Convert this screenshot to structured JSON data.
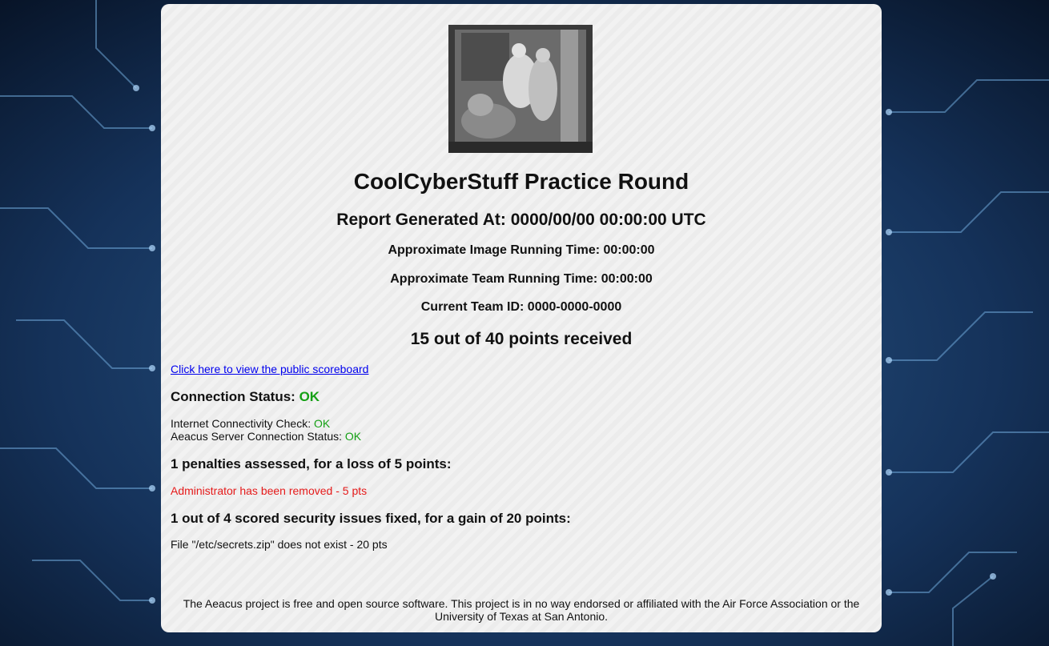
{
  "report": {
    "title": "CoolCyberStuff Practice Round",
    "generated": "Report Generated At: 0000/00/00 00:00:00 UTC",
    "image_time": "Approximate Image Running Time: 00:00:00",
    "team_time": "Approximate Team Running Time: 00:00:00",
    "team_id": "Current Team ID: 0000-0000-0000",
    "points": "15 out of 40 points received",
    "scoreboard_link": "Click here to view the public scoreboard"
  },
  "connection": {
    "heading_label": "Connection Status: ",
    "status": "OK",
    "internet_label": "Internet Connectivity Check: ",
    "internet_status": "OK",
    "server_label": "Aeacus Server Connection Status: ",
    "server_status": "OK"
  },
  "penalties": {
    "heading": "1 penalties assessed, for a loss of 5 points:",
    "items": [
      "Administrator has been removed - 5 pts"
    ]
  },
  "vulns": {
    "heading": "1 out of 4 scored security issues fixed, for a gain of 20 points:",
    "items": [
      "File \"/etc/secrets.zip\" does not exist - 20 pts"
    ]
  },
  "footer": "The Aeacus project is free and open source software. This project is in no way endorsed or affiliated with the Air Force Association or the University of Texas at San Antonio.",
  "colors": {
    "ok": "#15a015",
    "penalty": "#e51a1a",
    "link": "#0000ee",
    "background": "#0c1d38"
  },
  "icons": {
    "logo": "engraving-logo"
  }
}
